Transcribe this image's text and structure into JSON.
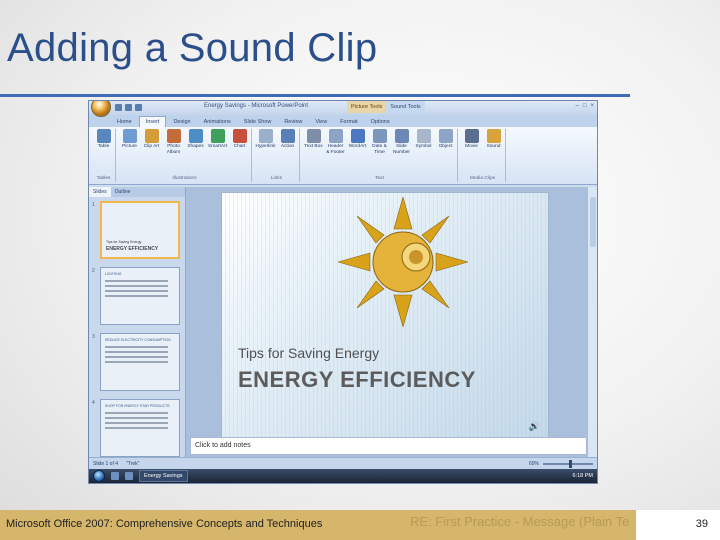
{
  "slide": {
    "title": "Adding a Sound Clip",
    "footer_text": "Microsoft Office 2007: Comprehensive Concepts and Techniques",
    "page_number": "39",
    "ghost_text": "RE: First Practice - Message (Plain Te"
  },
  "app": {
    "window_title": "Energy Savings - Microsoft PowerPoint",
    "context_tabs": [
      "Picture Tools",
      "Sound Tools"
    ],
    "window_controls": [
      "–",
      "□",
      "×"
    ],
    "tabs": [
      "Home",
      "Insert",
      "Design",
      "Animations",
      "Slide Show",
      "Review",
      "View",
      "Format",
      "Options"
    ],
    "active_tab": "Insert",
    "ribbon_groups": [
      {
        "label": "Tables",
        "buttons": [
          {
            "label": "Table",
            "color": "#5a86c0"
          }
        ]
      },
      {
        "label": "Illustrations",
        "buttons": [
          {
            "label": "Picture",
            "color": "#6f9bd4"
          },
          {
            "label": "Clip Art",
            "color": "#d49d3a"
          },
          {
            "label": "Photo Album",
            "color": "#c46b3b"
          },
          {
            "label": "Shapes",
            "color": "#4f8dc9"
          },
          {
            "label": "SmartArt",
            "color": "#3fa05a"
          },
          {
            "label": "Chart",
            "color": "#c6503b"
          }
        ]
      },
      {
        "label": "Links",
        "buttons": [
          {
            "label": "Hyperlink",
            "color": "#9bb0cc"
          },
          {
            "label": "Action",
            "color": "#5b7fb8"
          }
        ]
      },
      {
        "label": "Text",
        "buttons": [
          {
            "label": "Text Box",
            "color": "#7d8fa8"
          },
          {
            "label": "Header & Footer",
            "color": "#8ba3c4"
          },
          {
            "label": "WordArt",
            "color": "#4b78c1"
          },
          {
            "label": "Date & Time",
            "color": "#7d96bb"
          },
          {
            "label": "Slide Number",
            "color": "#6c88b6"
          },
          {
            "label": "Symbol",
            "color": "#a8b6ca"
          },
          {
            "label": "Object",
            "color": "#8ea4c4"
          }
        ]
      },
      {
        "label": "Media Clips",
        "buttons": [
          {
            "label": "Movie",
            "color": "#5a6f90"
          },
          {
            "label": "Sound",
            "color": "#d8a33a"
          }
        ]
      }
    ],
    "pane_tabs": [
      "Slides",
      "Outline"
    ],
    "thumbnails": [
      {
        "num": "1",
        "head": "",
        "line1": "Tips for Saving Energy",
        "line2": "ENERGY EFFICIENCY"
      },
      {
        "num": "2",
        "head": "LIGHTING",
        "line1": "",
        "line2": ""
      },
      {
        "num": "3",
        "head": "REDUCE ELECTRICITY CONSUMPTION",
        "line1": "",
        "line2": ""
      },
      {
        "num": "4",
        "head": "SHOP FOR ENERGY STAR PRODUCTS",
        "line1": "",
        "line2": ""
      }
    ],
    "slide_subtitle": "Tips for Saving Energy",
    "slide_heading": "ENERGY EFFICIENCY",
    "notes_placeholder": "Click to add notes",
    "status": {
      "slide_info": "Slide 1 of 4",
      "theme": "\"Trek\"",
      "zoom": "69%"
    },
    "taskbar": {
      "item": "Energy Savings",
      "clock": "6:18 PM"
    }
  },
  "colors": {
    "accent": "#2b4f8a",
    "rule": "#3f6cb4",
    "footer": "#d5b66a"
  }
}
